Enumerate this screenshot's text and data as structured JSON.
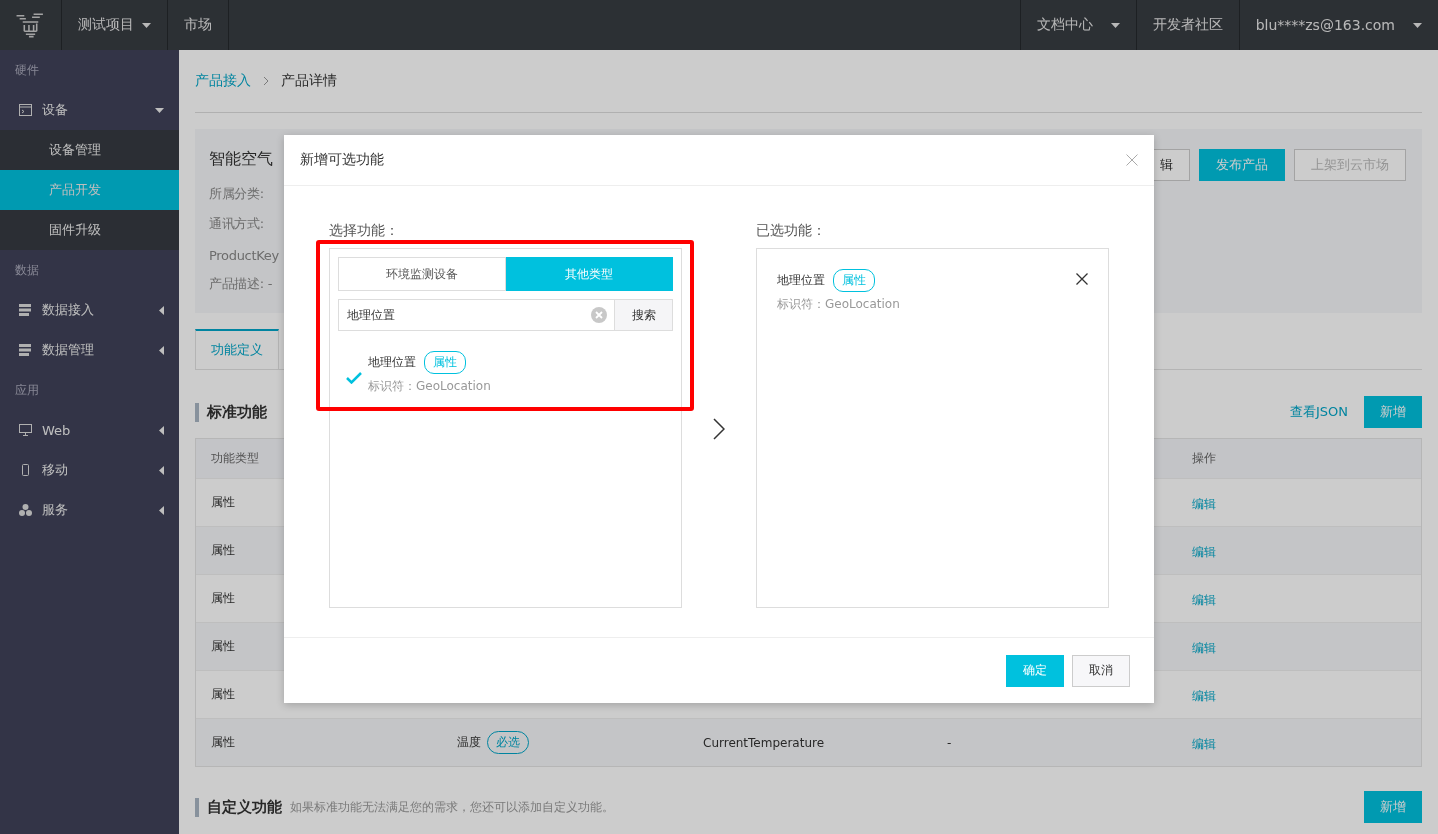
{
  "topbar": {
    "left": [
      {
        "label": "测试项目",
        "dropdown": true
      },
      {
        "label": "市场",
        "dropdown": false
      }
    ],
    "right": [
      {
        "label": "文档中心",
        "dropdown": true
      },
      {
        "label": "开发者社区",
        "dropdown": false
      },
      {
        "label": "blu****zs@163.com",
        "dropdown": true
      }
    ]
  },
  "sidebar": {
    "sections": [
      {
        "title": "硬件",
        "items": [
          {
            "label": "设备",
            "kind": "window",
            "expanded": true,
            "children": [
              {
                "label": "设备管理",
                "selected": false
              },
              {
                "label": "产品开发",
                "selected": true
              },
              {
                "label": "固件升级",
                "selected": false
              }
            ]
          }
        ]
      },
      {
        "title": "数据",
        "items": [
          {
            "label": "数据接入",
            "kind": "server",
            "expanded": false
          },
          {
            "label": "数据管理",
            "kind": "server",
            "expanded": false
          }
        ]
      },
      {
        "title": "应用",
        "items": [
          {
            "label": "Web",
            "kind": "monitor",
            "expanded": false
          },
          {
            "label": "移动",
            "kind": "phone",
            "expanded": false
          },
          {
            "label": "服务",
            "kind": "cluster",
            "expanded": false
          }
        ]
      }
    ]
  },
  "breadcrumb": [
    {
      "label": "产品接入",
      "kind": "link"
    },
    {
      "label": "产品详情",
      "kind": "current"
    }
  ],
  "product": {
    "title": "智能空气",
    "fields": [
      "所属分类:",
      "通讯方式:",
      "ProductKey",
      "产品描述: -"
    ],
    "buttons": [
      {
        "label": "辑",
        "kind": "outline"
      },
      {
        "label": "发布产品",
        "kind": "primary"
      },
      {
        "label": "上架到云市场",
        "kind": "disabled"
      }
    ]
  },
  "tabs": [
    {
      "label": "功能定义",
      "selected": true
    }
  ],
  "standard": {
    "title": "标准功能",
    "link": "查看JSON",
    "add": "新增",
    "header": {
      "type": "功能类型",
      "action": "操作"
    },
    "rows": [
      {
        "type": "属性",
        "action": "编辑"
      },
      {
        "type": "属性",
        "action": "编辑"
      },
      {
        "type": "属性",
        "action": "编辑"
      },
      {
        "type": "属性",
        "action": "编辑"
      },
      {
        "type": "属性",
        "action": "编辑"
      },
      {
        "type": "属性",
        "name": "温度",
        "tag": "必选",
        "identifier": "CurrentTemperature",
        "column_4": "-",
        "action": "编辑"
      }
    ]
  },
  "custom": {
    "title": "自定义功能",
    "description": "如果标准功能无法满足您的需求，您还可以添加自定义功能。",
    "add": "新增"
  },
  "modal": {
    "title": "新增可选功能",
    "left_label": "选择功能：",
    "tabs": [
      {
        "label": "环境监测设备",
        "selected": false
      },
      {
        "label": "其他类型",
        "selected": true
      }
    ],
    "search": {
      "value": "地理位置",
      "button": "搜索"
    },
    "results": [
      {
        "name": "地理位置",
        "tag": "属性",
        "identifier": "标识符：GeoLocation",
        "checked": true
      }
    ],
    "right_label": "已选功能：",
    "chosen": [
      {
        "name": "地理位置",
        "tag": "属性",
        "identifier": "标识符：GeoLocation"
      }
    ],
    "buttons": [
      {
        "label": "确定",
        "kind": "primary"
      },
      {
        "label": "取消",
        "kind": "default"
      }
    ]
  }
}
